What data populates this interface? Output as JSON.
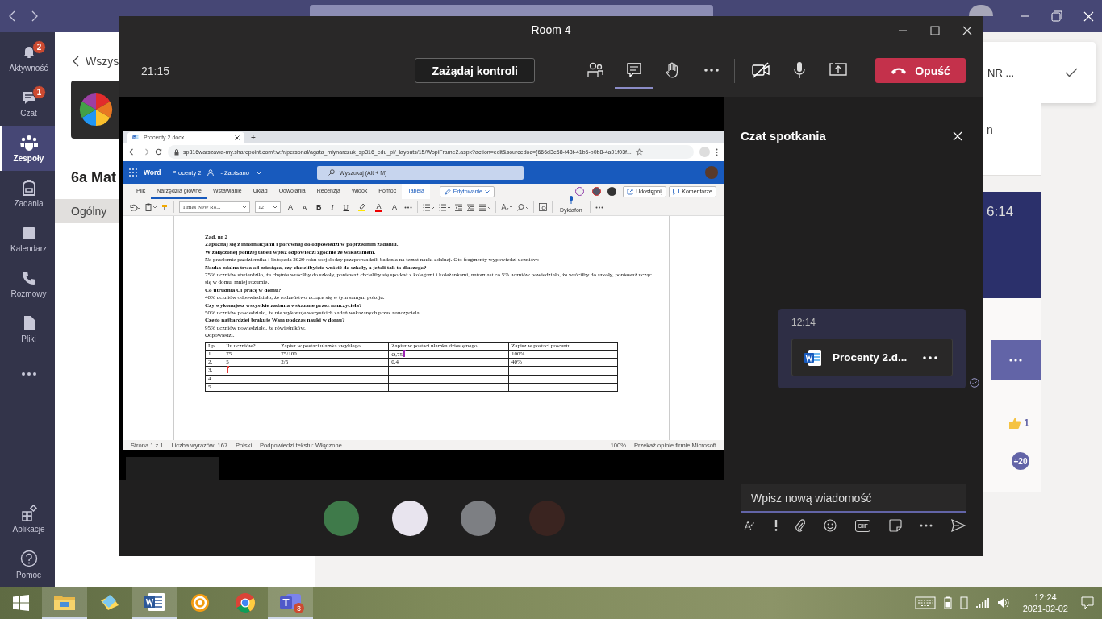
{
  "teams": {
    "rail": [
      {
        "kind": "bell",
        "label": "Aktywność",
        "badge": "2",
        "selected": false
      },
      {
        "kind": "chat",
        "label": "Czat",
        "badge": "1",
        "selected": false
      },
      {
        "kind": "teams",
        "label": "Zespoły",
        "selected": true
      },
      {
        "kind": "bag",
        "label": "Zadania",
        "selected": false
      },
      {
        "kind": "calendar",
        "label": "Kalendarz",
        "selected": false
      },
      {
        "kind": "phone",
        "label": "Rozmowy",
        "selected": false
      },
      {
        "kind": "file",
        "label": "Pliki",
        "selected": false
      },
      {
        "kind": "more",
        "selected": false
      }
    ],
    "rail_bottom": [
      {
        "kind": "apps",
        "label": "Aplikacje"
      },
      {
        "kind": "help",
        "label": "Pomoc"
      }
    ],
    "back_link": "Wszys",
    "team_name": "6a Mat",
    "channel": {
      "label": "Ogólny",
      "selected": true
    },
    "notification": "NR ...",
    "card_text": "n",
    "time": "6:14",
    "reaction": "1",
    "more_count": "+20"
  },
  "meeting": {
    "title": "Room 4",
    "duration": "21:15",
    "request_control": "Zażądaj kontroli",
    "chat_open": true,
    "camera_on": false,
    "leave": "Opuść",
    "screen": {
      "browser_tab": "Procenty 2.docx",
      "new_tab": "+",
      "url": "sp316warszawa-my.sharepoint.com/:w:/r/personal/agata_mlynarczuk_sp316_edu_pl/_layouts/15/WopiFrame2.aspx?action=edit&sourcedoc={666d3e58-f43f-41b5-b0b8-4a01f03f...",
      "word": {
        "app": "Word",
        "doc_title": "Procenty 2",
        "status": "- Zapisano",
        "search": "Wyszukaj (Alt + M)",
        "tabs": [
          {
            "label": "Plik",
            "selected": false,
            "kind": "normal"
          },
          {
            "label": "Narzędzia główne",
            "selected": true,
            "kind": "normal"
          },
          {
            "label": "Wstawianie",
            "selected": false,
            "kind": "normal"
          },
          {
            "label": "Układ",
            "selected": false,
            "kind": "normal"
          },
          {
            "label": "Odwołania",
            "selected": false,
            "kind": "normal"
          },
          {
            "label": "Recenzja",
            "selected": false,
            "kind": "normal"
          },
          {
            "label": "Widok",
            "selected": false,
            "kind": "normal"
          },
          {
            "label": "Pomoc",
            "selected": false,
            "kind": "normal"
          },
          {
            "label": "Tabela",
            "selected": false,
            "kind": "contextual"
          }
        ],
        "editing": "Edytowanie",
        "share": "Udostępnij",
        "comments": "Komentarze",
        "font": "Times New Ro...",
        "size": "12",
        "format_buttons": [
          {
            "kind": "grow",
            "label": "A"
          },
          {
            "kind": "shrink",
            "label": "A"
          },
          {
            "kind": "bold",
            "label": "B"
          },
          {
            "kind": "italic",
            "label": "I"
          },
          {
            "kind": "underline",
            "label": "U"
          },
          {
            "kind": "highlight"
          },
          {
            "kind": "font_color",
            "label": "A"
          },
          {
            "kind": "clear",
            "label": "A"
          }
        ],
        "dictate": "Dyktafon"
      },
      "document": {
        "paragraphs": [
          {
            "kind": "bold",
            "text": "Zad. nr 2"
          },
          {
            "kind": "bold",
            "text": "Zapoznaj się z informacjami i porównaj do odpowiedzi w poprzednim zadaniu."
          },
          {
            "kind": "bold",
            "text": "W załączonej poniżej tabeli wpisz odpowiedzi zgodnie ze wskazaniem."
          },
          {
            "kind": "plain",
            "text": "Na przełomie października i listopada 2020 roku socjolodzy przeprowadzili badania na temat nauki zdalnej. Oto fragmenty wypowiedzi uczniów:"
          },
          {
            "kind": "bold",
            "text": "Nauka zdalna trwa od miesiąca, czy chcielibyście wrócić do szkoły, a jeżeli tak to dlaczego?"
          },
          {
            "kind": "plain",
            "text": "75% uczniów stwierdziło, że chętnie wróciłby do szkoły, ponieważ chcieliby się spotkać z kolegami i koleżankami, natomiast co 5% uczniów powiedziało, że wróciłby do szkoły, ponieważ ucząc się w domu, mniej rozumie."
          },
          {
            "kind": "bold",
            "text": "Co utrudnia Ci pracę w domu?"
          },
          {
            "kind": "plain",
            "text": "40% uczniów odpowiedziało, że rodzeństwo uczące się w tym samym pokoju."
          },
          {
            "kind": "bold",
            "text": "Czy wykonujesz wszystkie zadania wskazane przez nauczyciela?"
          },
          {
            "kind": "plain",
            "text": "50% uczniów powiedziało, że nie wykonuje wszystkich zadań wskazanych przez nauczyciela."
          },
          {
            "kind": "bold",
            "text": "Czego najbardziej brakuje Wam podczas nauki w domu?"
          },
          {
            "kind": "plain",
            "text": "95% uczniów powiedziało, że rówieśników."
          },
          {
            "kind": "plain",
            "text": "Odpowiedzi."
          }
        ],
        "table": {
          "columns": [
            "Lp",
            "Ilu uczniów?",
            "Zapisz w postaci ułamka zwykłego.",
            "Zapisz w postaci ułamka dziesiętnego.",
            "Zapisz w postaci procentu."
          ],
          "rows": [
            [
              {
                "text": "1."
              },
              {
                "text": "75"
              },
              {
                "text": "75/100"
              },
              {
                "text": "O,75",
                "color": "#9c27b0"
              },
              {
                "text": "100%"
              }
            ],
            [
              {
                "text": "2."
              },
              {
                "text": "5"
              },
              {
                "text": "2/5"
              },
              {
                "text": "0,4"
              },
              {
                "text": "40%"
              }
            ],
            [
              {
                "text": "3."
              },
              {
                "color": "#e53935"
              },
              {},
              {},
              {}
            ],
            [
              {
                "text": "4."
              },
              {},
              {},
              {},
              {}
            ],
            [
              {
                "text": "5."
              },
              {},
              {},
              {},
              {}
            ]
          ]
        }
      },
      "status_bar": [
        "Strona 1 z 1",
        "Liczba wyrazów: 167",
        "Polski",
        "Podpowiedzi tekstu: Włączone"
      ],
      "zoom": "100%",
      "feedback": "Przekaż opinie firmie Microsoft"
    },
    "chat": {
      "title": "Czat spotkania",
      "messages": [
        {
          "time": "12:14",
          "file": "Procenty 2.d..."
        }
      ],
      "gif_label": "GIF",
      "placeholder": "Wpisz nową wiadomość"
    }
  },
  "taskbar": {
    "apps": [
      {
        "kind": "start"
      },
      {
        "kind": "explorer"
      },
      {
        "kind": "notes"
      },
      {
        "kind": "word"
      },
      {
        "kind": "gear"
      },
      {
        "kind": "chrome"
      },
      {
        "kind": "teams",
        "badge": "3"
      }
    ],
    "time": "12:24",
    "date": "2021-02-02"
  }
}
